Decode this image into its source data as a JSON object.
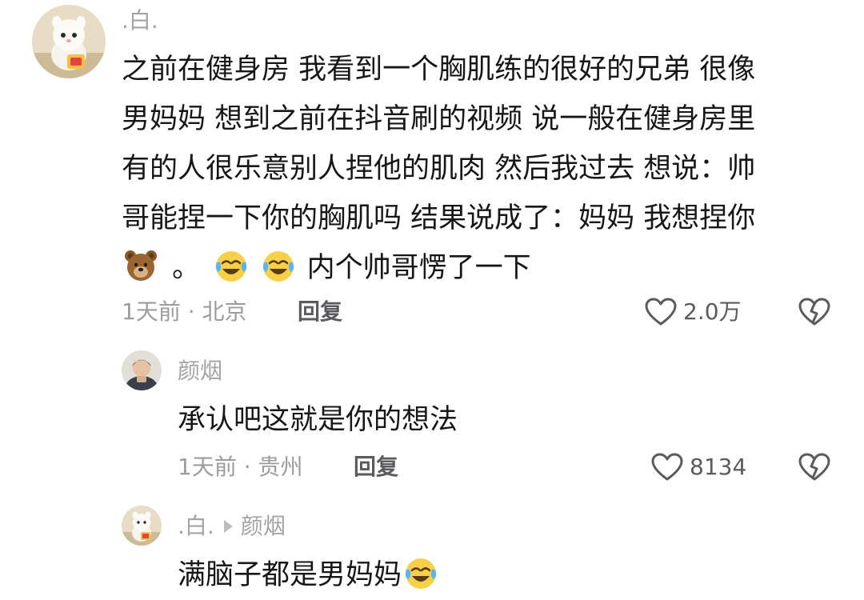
{
  "main_comment": {
    "username": ".白.",
    "text_lines": [
      "之前在健身房 我看到一个胸肌练的很好的兄弟 很像",
      "男妈妈 想到之前在抖音刷的视频 说一般在健身房里",
      "有的人很乐意别人捏他的肌肉 然后我过去 想说：帅",
      "哥能捏一下你的胸肌吗 结果说成了：妈妈 我想捏你"
    ],
    "last_line_punct": "。",
    "last_line_tail": "内个帅哥愣了一下",
    "meta": "1天前 · 北京",
    "reply_label": "回复",
    "like_count": "2.0万",
    "icons": [
      "bear-emoji",
      "crying-laughing-emoji",
      "heart-icon",
      "dislike-icon"
    ]
  },
  "replies": [
    {
      "username": "颜烟",
      "text": "承认吧这就是你的想法",
      "meta": "1天前 · 贵州",
      "reply_label": "回复",
      "like_count": "8134"
    },
    {
      "username": ".白.",
      "reply_to": "颜烟",
      "text": "满脑子都是男妈妈",
      "icons": [
        "crying-laughing-emoji"
      ]
    }
  ],
  "colors": {
    "text": "#171717",
    "muted": "#a3a3a6",
    "action": "#5b5b5f"
  }
}
